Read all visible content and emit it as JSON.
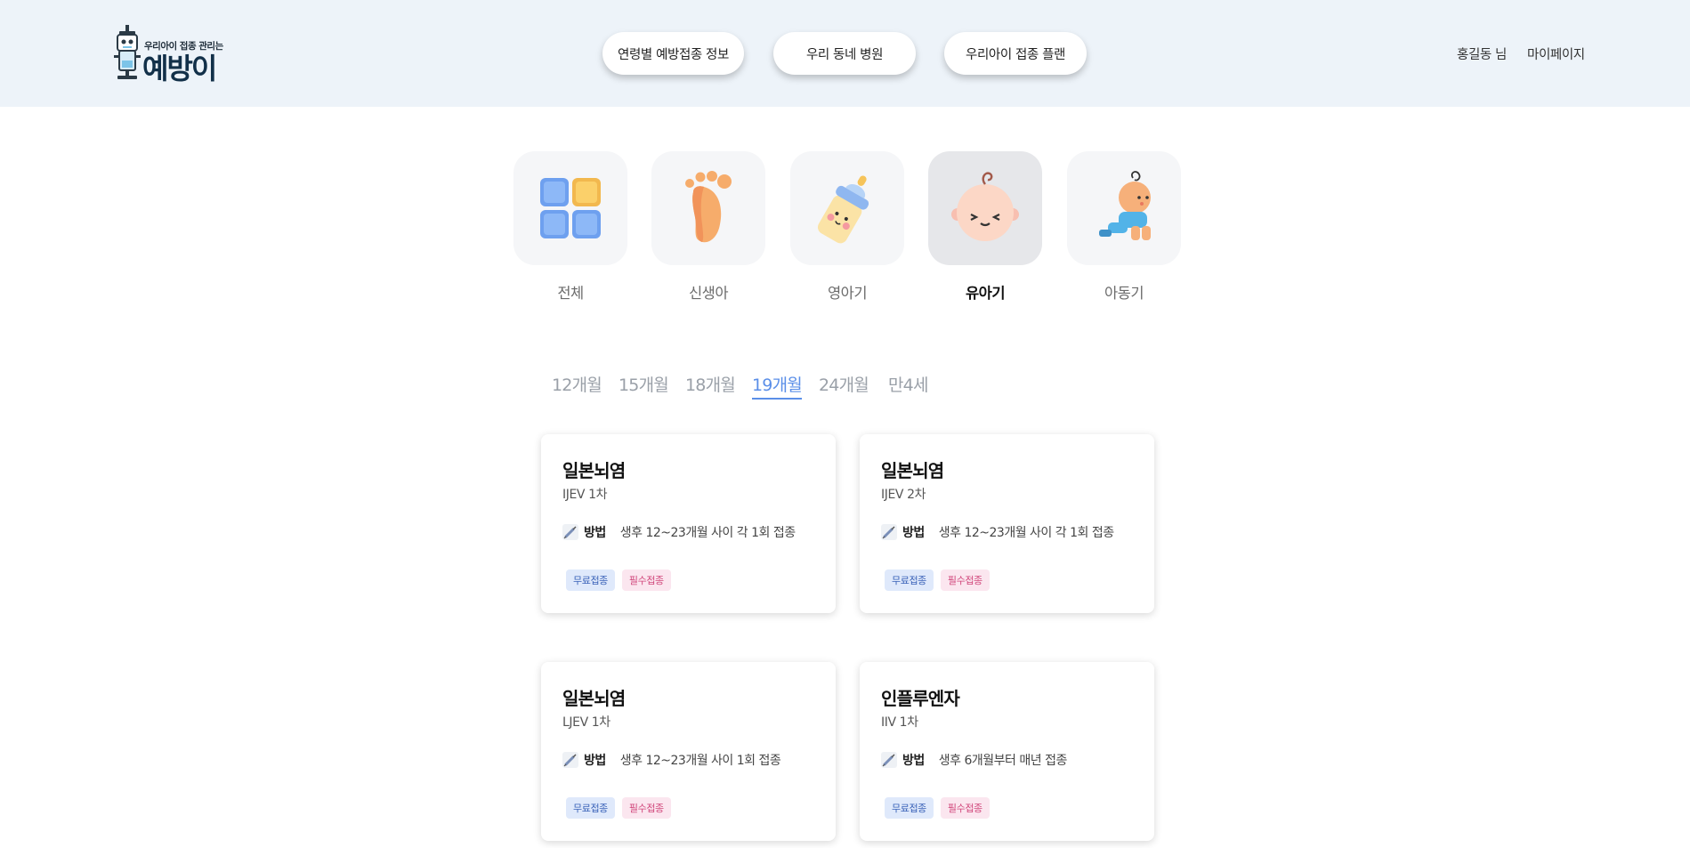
{
  "header": {
    "logo_tagline": "우리아이 접종 관리는",
    "logo_name": "예방이",
    "nav": [
      {
        "label": "연령별 예방접종 정보"
      },
      {
        "label": "우리 동네 병원"
      },
      {
        "label": "우리아이 접종 플랜"
      }
    ],
    "user_name": "홍길동 님",
    "mypage_label": "마이페이지"
  },
  "categories": [
    {
      "label": "전체",
      "icon": "grid-blocks-icon",
      "active": false
    },
    {
      "label": "신생아",
      "icon": "baby-foot-icon",
      "active": false
    },
    {
      "label": "영아기",
      "icon": "baby-bottle-icon",
      "active": false
    },
    {
      "label": "유아기",
      "icon": "baby-face-icon",
      "active": true
    },
    {
      "label": "아동기",
      "icon": "crawling-baby-icon",
      "active": false
    }
  ],
  "months": [
    {
      "label": "12개월",
      "active": false
    },
    {
      "label": "15개월",
      "active": false
    },
    {
      "label": "18개월",
      "active": false
    },
    {
      "label": "19개월",
      "active": true
    },
    {
      "label": "24개월",
      "active": false
    },
    {
      "label": "만4세",
      "active": false
    }
  ],
  "vaccines": [
    {
      "title": "일본뇌염",
      "sub": "IJEV 1차",
      "method_label": "방법",
      "method": "생후 12~23개월 사이 각 1회 접종",
      "tags": [
        "무료접종",
        "필수접종"
      ]
    },
    {
      "title": "일본뇌염",
      "sub": "IJEV 2차",
      "method_label": "방법",
      "method": "생후 12~23개월 사이 각 1회 접종",
      "tags": [
        "무료접종",
        "필수접종"
      ]
    },
    {
      "title": "일본뇌염",
      "sub": "LJEV 1차",
      "method_label": "방법",
      "method": "생후 12~23개월 사이 1회 접종",
      "tags": [
        "무료접종",
        "필수접종"
      ]
    },
    {
      "title": "인플루엔자",
      "sub": "IIV 1차",
      "method_label": "방법",
      "method": "생후 6개월부터 매년 접종",
      "tags": [
        "무료접종",
        "필수접종"
      ]
    }
  ],
  "colors": {
    "header_bg": "#edf3f9",
    "accent": "#5b8fe8",
    "tag_free": "#3a63b8",
    "tag_required": "#d1487c"
  }
}
